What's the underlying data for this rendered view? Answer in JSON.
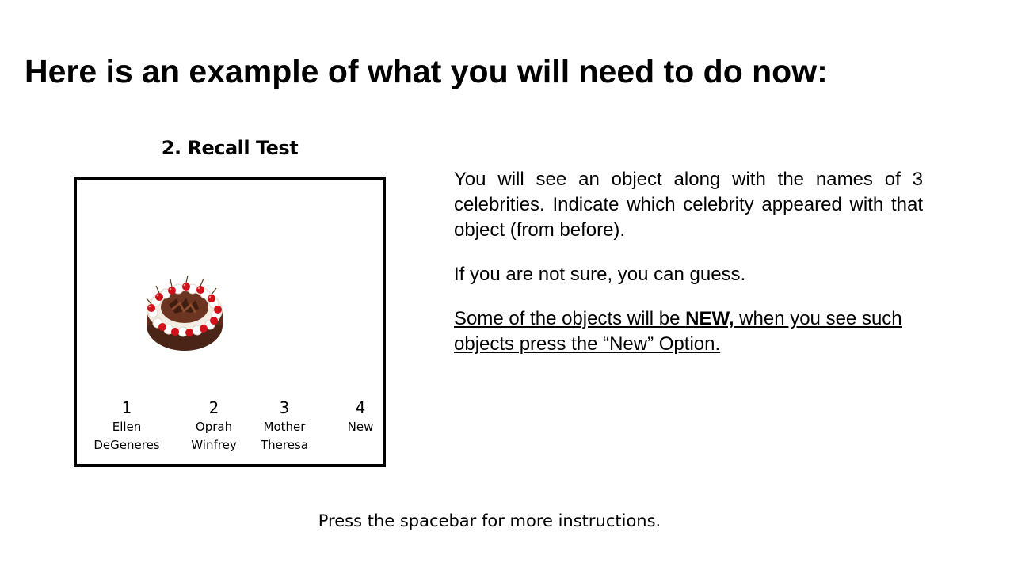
{
  "heading": "Here is an example of what you will need to do now:",
  "section_title": "2. Recall Test",
  "example": {
    "image": "black-forest-cake",
    "options": [
      {
        "number": "1",
        "label": "Ellen\nDeGeneres"
      },
      {
        "number": "2",
        "label": "Oprah\nWinfrey"
      },
      {
        "number": "3",
        "label": "Mother\nTheresa"
      },
      {
        "number": "4",
        "label": "New"
      }
    ]
  },
  "instructions": {
    "paragraph_1": "You will see an object along with the names of 3 celebrities. Indicate which celebrity appeared with that object (from before).",
    "paragraph_2": "If you are not sure, you can guess.",
    "paragraph_3_before": "Some of the objects will be ",
    "paragraph_3_bold": "NEW,",
    "paragraph_3_after": " when you see such objects press the “New” Option."
  },
  "footer": "Press the spacebar for more instructions."
}
